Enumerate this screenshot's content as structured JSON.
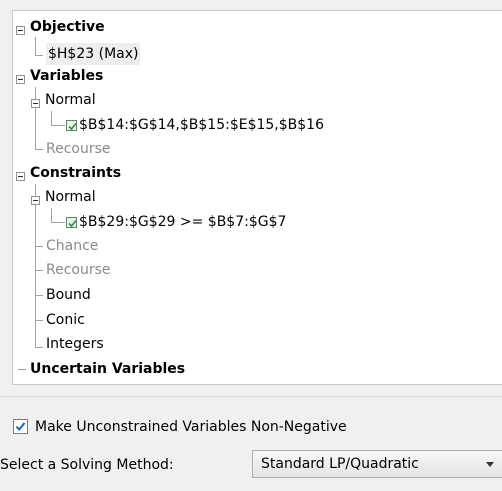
{
  "tree": {
    "objective": {
      "label": "Objective",
      "cell": "$H$23 (Max)"
    },
    "variables": {
      "label": "Variables",
      "normal": {
        "label": "Normal",
        "item": "$B$14:$G$14,$B$15:$E$15,$B$16"
      },
      "recourse": "Recourse"
    },
    "constraints": {
      "label": "Constraints",
      "normal": {
        "label": "Normal",
        "item": "$B$29:$G$29 >= $B$7:$G$7"
      },
      "chance": "Chance",
      "recourse": "Recourse",
      "bound": "Bound",
      "conic": "Conic",
      "integers": "Integers"
    },
    "uncertain": "Uncertain Variables"
  },
  "options": {
    "nonneg_label": "Make Unconstrained Variables Non-Negative",
    "nonneg_checked": true
  },
  "solving": {
    "label": "Select a Solving Method:",
    "value": "Standard LP/Quadratic"
  },
  "colors": {
    "check": "#1565c0",
    "item_check": "#2e8b57"
  }
}
